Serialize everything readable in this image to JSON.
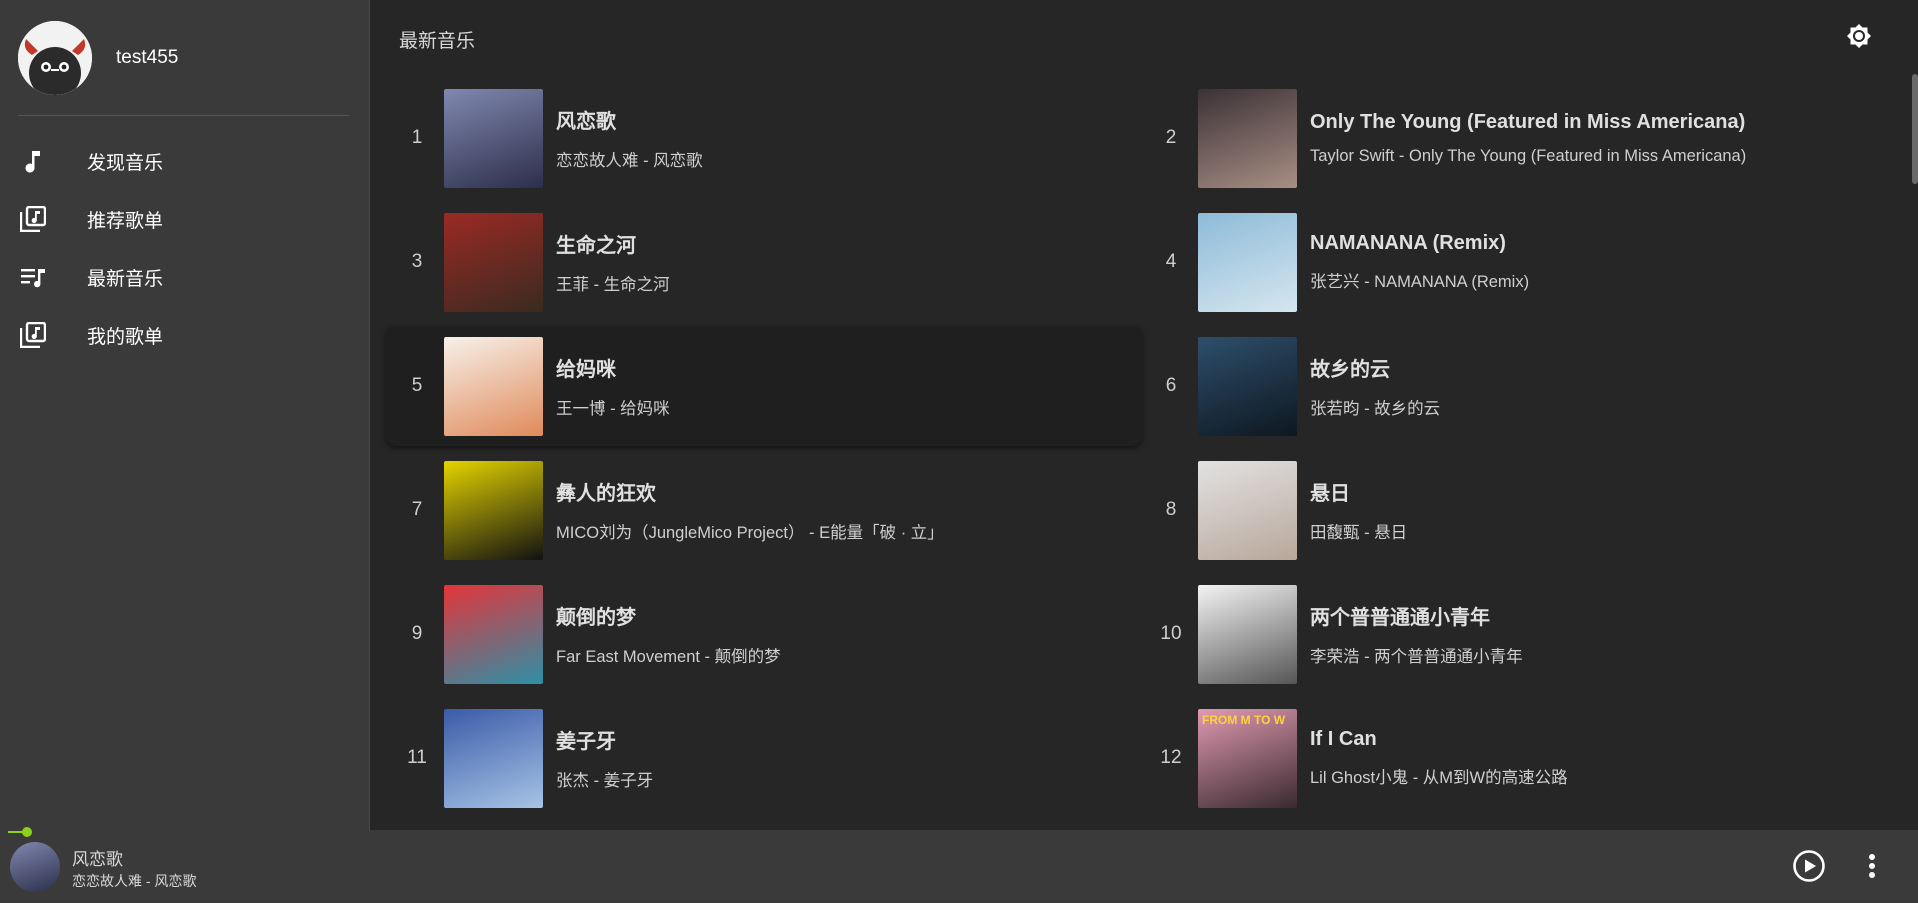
{
  "user": {
    "name": "test455"
  },
  "nav": [
    {
      "label": "发现音乐",
      "icon": "music-note-icon"
    },
    {
      "label": "推荐歌单",
      "icon": "library-music-icon"
    },
    {
      "label": "最新音乐",
      "icon": "queue-music-icon"
    },
    {
      "label": "我的歌单",
      "icon": "library-music-icon"
    }
  ],
  "main": {
    "title": "最新音乐"
  },
  "songs": [
    {
      "index": "1",
      "title": "风恋歌",
      "sub": "恋恋故人难 - 风恋歌",
      "cover": [
        "#8088b0",
        "#2c2f4a"
      ]
    },
    {
      "index": "2",
      "title": "Only The Young (Featured in Miss Americana)",
      "sub": "Taylor Swift - Only The Young (Featured in Miss Americana)",
      "cover": [
        "#3b3136",
        "#a88f84"
      ]
    },
    {
      "index": "3",
      "title": "生命之河",
      "sub": "王菲 - 生命之河",
      "cover": [
        "#9b2a24",
        "#3a2a20"
      ]
    },
    {
      "index": "4",
      "title": "NAMANANA (Remix)",
      "sub": "张艺兴 - NAMANANA (Remix)",
      "cover": [
        "#8dbbd8",
        "#d5e6ef"
      ]
    },
    {
      "index": "5",
      "title": "给妈咪",
      "sub": "王一博 - 给妈咪",
      "cover": [
        "#f7f1ea",
        "#e08a5a"
      ]
    },
    {
      "index": "6",
      "title": "故乡的云",
      "sub": "张若昀 - 故乡的云",
      "cover": [
        "#2d4f6b",
        "#0e1720"
      ]
    },
    {
      "index": "7",
      "title": "彝人的狂欢",
      "sub": "MICO刘为（JungleMico Project） - E能量「破 · 立」",
      "cover": [
        "#e5d400",
        "#111111"
      ]
    },
    {
      "index": "8",
      "title": "悬日",
      "sub": "田馥甄 - 悬日",
      "cover": [
        "#e2e2e2",
        "#b8a79a"
      ]
    },
    {
      "index": "9",
      "title": "颠倒的梦",
      "sub": "Far East Movement - 颠倒的梦",
      "cover": [
        "#e3353a",
        "#2d8fa7"
      ]
    },
    {
      "index": "10",
      "title": "两个普普通通小青年",
      "sub": "李荣浩 - 两个普普通通小青年",
      "cover": [
        "#f4f4f4",
        "#555555"
      ]
    },
    {
      "index": "11",
      "title": "姜子牙",
      "sub": "张杰 - 姜子牙",
      "cover": [
        "#3b5aa8",
        "#a6c4e6"
      ]
    },
    {
      "index": "12",
      "title": "If I Can",
      "sub": "Lil Ghost小鬼 - 从M到W的高速公路",
      "cover": [
        "#e09ab0",
        "#3a2a30"
      ],
      "cover_text": "FROM M TO W"
    }
  ],
  "player": {
    "title": "风恋歌",
    "sub": "恋恋故人难 - 风恋歌"
  },
  "colors": {
    "accent": "#8bd11a",
    "sidebar": "#3a3a3a",
    "main": "#262626"
  }
}
